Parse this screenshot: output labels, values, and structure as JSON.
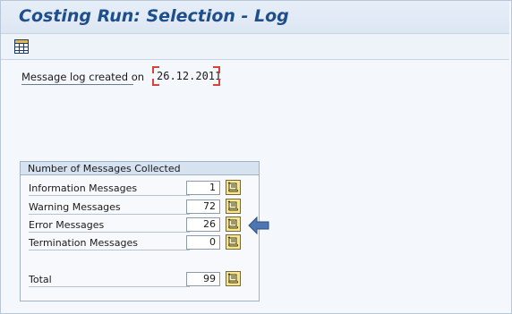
{
  "window": {
    "title": "Costing Run: Selection - Log"
  },
  "toolbar": {
    "layout_icon": "grid-layout-icon"
  },
  "log": {
    "created_label": "Message log created on",
    "created_date": "26.12.2011"
  },
  "messages": {
    "header": "Number of Messages Collected",
    "rows": [
      {
        "label": "Information Messages",
        "count": "1"
      },
      {
        "label": "Warning Messages",
        "count": "72"
      },
      {
        "label": "Error Messages",
        "count": "26"
      },
      {
        "label": "Termination Messages",
        "count": "0"
      }
    ],
    "total": {
      "label": "Total",
      "count": "99"
    }
  },
  "icons": {
    "display_log": "scroll-log-icon",
    "highlight": "arrow-left-icon"
  },
  "colors": {
    "title": "#1f4f8a",
    "log_button": "#fbe48a",
    "required_marker": "#d9423a",
    "arrow": "#4d77b1"
  }
}
